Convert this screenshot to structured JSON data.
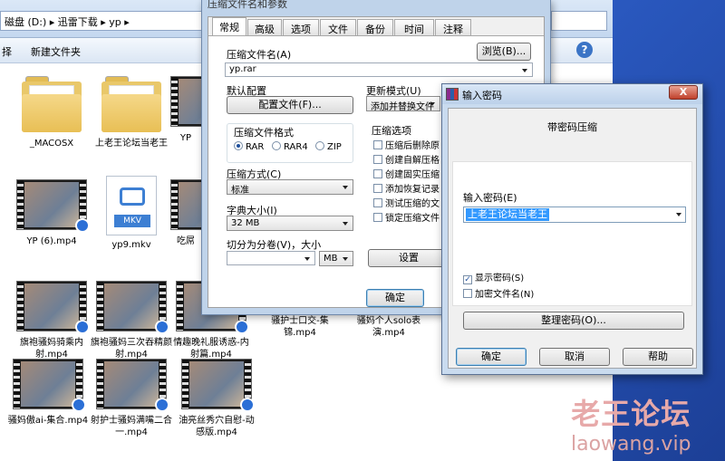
{
  "explorer": {
    "breadcrumb": "磁盘 (D:) ▸ 迅雷下载 ▸ yp ▸",
    "toolbar": {
      "share": "择",
      "new_folder": "新建文件夹"
    },
    "files": [
      {
        "name": "_MACOSX",
        "type": "folder"
      },
      {
        "name": "上老王论坛当老王",
        "type": "folder"
      },
      {
        "name": "YP",
        "type": "video"
      },
      {
        "name": "YP (6).mp4",
        "type": "video"
      },
      {
        "name": "yp9.mkv",
        "type": "mkv"
      },
      {
        "name": "吃屌",
        "type": "video"
      },
      {
        "name": "旗袍骚妈骑乘内射.mp4",
        "type": "video"
      },
      {
        "name": "旗袍骚妈三次吞精颜射.mp4",
        "type": "video"
      },
      {
        "name": "情趣晚礼服诱惑-内射篇.mp4",
        "type": "video"
      },
      {
        "name": "骚护士口交-集锦.mp4",
        "type": "video"
      },
      {
        "name": "骚妈个人solo表演.mp4",
        "type": "video"
      },
      {
        "name": "骚妈傲ai-集合.mp4",
        "type": "video"
      },
      {
        "name": "射护士骚妈满嘴二合一.mp4",
        "type": "video"
      },
      {
        "name": "油亮丝秀穴自慰-动感版.mp4",
        "type": "video"
      }
    ]
  },
  "rar": {
    "title": "压缩文件名和参数",
    "tabs": [
      "常规",
      "高级",
      "选项",
      "文件",
      "备份",
      "时间",
      "注释"
    ],
    "archive_name_label": "压缩文件名(A)",
    "archive_name_value": "yp.rar",
    "browse_button": "浏览(B)...",
    "default_config_label": "默认配置",
    "profiles_button": "配置文件(F)...",
    "update_mode_label": "更新模式(U)",
    "update_mode_value": "添加并替换文件",
    "format_label": "压缩文件格式",
    "formats": [
      "RAR",
      "RAR4",
      "ZIP"
    ],
    "method_label": "压缩方式(C)",
    "method_value": "标准",
    "dict_label": "字典大小(I)",
    "dict_value": "32 MB",
    "split_label": "切分为分卷(V)，大小",
    "split_unit": "MB",
    "options_label": "压缩选项",
    "options": [
      "压缩后删除原",
      "创建自解压格",
      "创建固实压缩",
      "添加恢复记录",
      "测试压缩的文",
      "锁定压缩文件"
    ],
    "set_password_button": "设置",
    "ok_button": "确定"
  },
  "password_dialog": {
    "title": "输入密码",
    "close": "X",
    "heading": "带密码压缩",
    "enter_label": "输入密码(E)",
    "password_value": "上老王论坛当老王",
    "show_password": "显示密码(S)",
    "show_password_checked": true,
    "encrypt_names": "加密文件名(N)",
    "encrypt_names_checked": false,
    "organize_button": "整理密码(O)...",
    "ok_button": "确定",
    "cancel_button": "取消",
    "help_button": "帮助"
  },
  "watermark": {
    "line1": "老王论坛",
    "line2": "laowang.vip"
  }
}
